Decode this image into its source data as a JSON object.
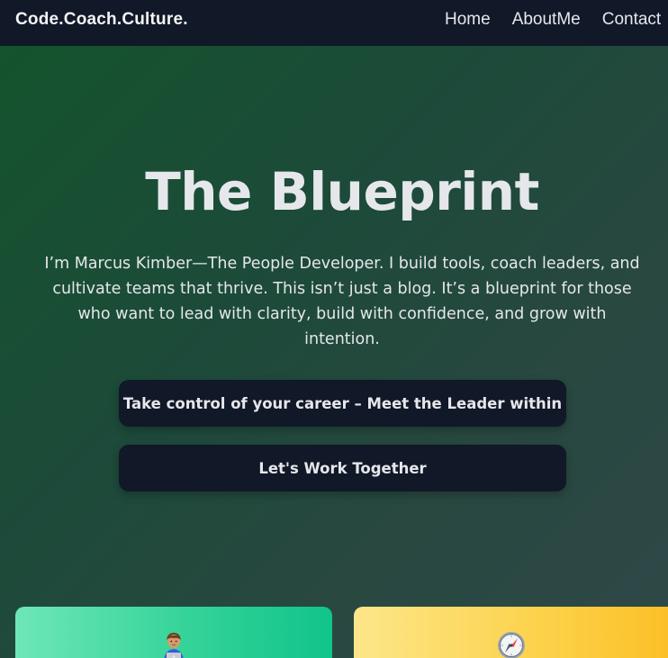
{
  "nav": {
    "brand": "Code.Coach.Culture.",
    "links": [
      "Home",
      "AboutMe",
      "Contact"
    ]
  },
  "hero": {
    "title": "The Blueprint",
    "text": "I’m Marcus Kimber—The People Developer. I build tools, coach leaders, and cultivate teams that thrive. This isn’t just a blog. It’s a blueprint for those who want to lead with clarity, build with confidence, and grow with intention.",
    "cta_primary": "Take control of your career – Meet the Leader within",
    "cta_secondary": "Let's Work Together"
  },
  "cards": [
    {
      "icon": "technologist-icon",
      "color": "#34d399"
    },
    {
      "icon": "compass-icon",
      "color": "#fcd34d"
    }
  ]
}
